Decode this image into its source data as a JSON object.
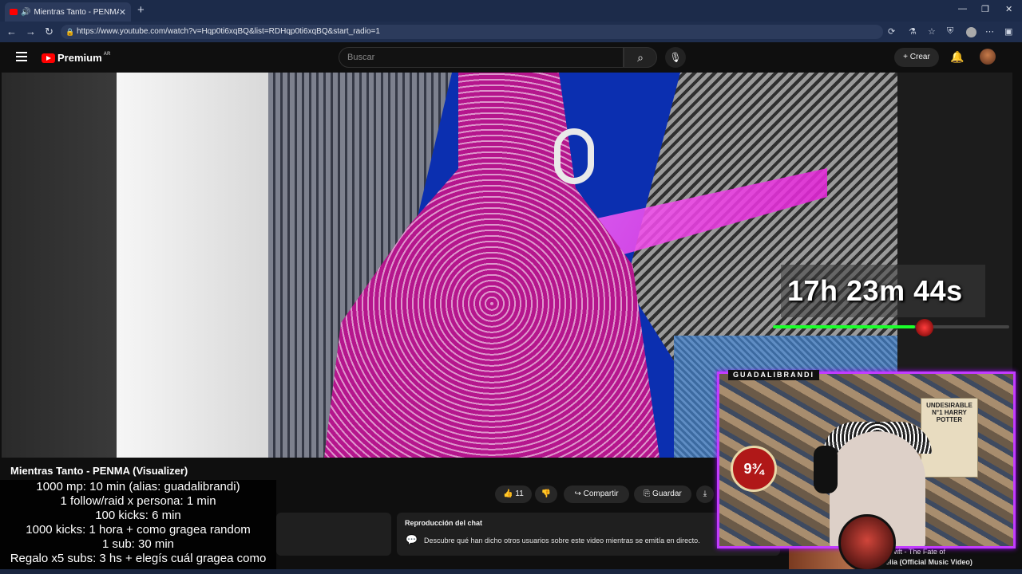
{
  "browser": {
    "tab_title": "Mientras Tanto - PENMA (Vis",
    "url": "https://www.youtube.com/watch?v=Hqp0ti6xqBQ&list=RDHqp0ti6xqBQ&start_radio=1"
  },
  "header": {
    "brand": "Premium",
    "region": "AR",
    "search_placeholder": "Buscar",
    "create_label": "Crear"
  },
  "video": {
    "title": "Mientras Tanto - PENMA (Visualizer)",
    "like_count": "11",
    "share_label": "Compartir",
    "save_label": "Guardar"
  },
  "overlay": {
    "timer": "17h 23m 44s",
    "progress_fraction": 0.6,
    "webcam_name": "GUADALIBRANDI",
    "poster_text": "UNDESIRABLE N°1 HARRY POTTER",
    "platform_text": "9¾",
    "rules": [
      "1000 mp: 10 min (alias: guadalibrandi)",
      "1 follow/raid x persona: 1 min",
      "100 kicks: 6 min",
      "1000 kicks: 1 hora + como gragea random",
      "1 sub: 30 min",
      "Regalo x5 subs: 3 hs + elegís cuál gragea como"
    ]
  },
  "chat_replay": {
    "heading": "Reproducción del chat",
    "body": "Descubre qué han dicho otros usuarios sobre este video mientras se emitía en directo."
  },
  "suggestion": {
    "line1": "lor Swift - The Fate of",
    "line2": "phelia (Official Music Video)"
  }
}
